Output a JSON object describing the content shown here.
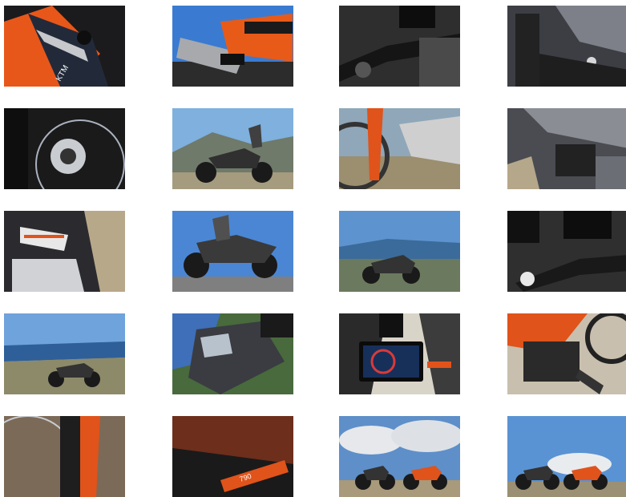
{
  "gallery": {
    "thumbnails": [
      {
        "subject": "orange-fairing-closeup"
      },
      {
        "subject": "exhaust-closeup"
      },
      {
        "subject": "handlebar-dash-closeup"
      },
      {
        "subject": "frame-closeup"
      },
      {
        "subject": "front-brake-closeup"
      },
      {
        "subject": "bike-side-mountain"
      },
      {
        "subject": "fork-closeup"
      },
      {
        "subject": "engine-closeup"
      },
      {
        "subject": "tank-shroud-closeup"
      },
      {
        "subject": "bike-side-sky"
      },
      {
        "subject": "bike-coast-view"
      },
      {
        "subject": "mirror-handlebar-closeup"
      },
      {
        "subject": "bike-sea-panorama"
      },
      {
        "subject": "headlight-closeup"
      },
      {
        "subject": "tft-dashboard"
      },
      {
        "subject": "orange-engine-closeup"
      },
      {
        "subject": "front-wheel-closeup"
      },
      {
        "subject": "tank-790-logo"
      },
      {
        "subject": "two-bikes-clouds"
      },
      {
        "subject": "two-bikes-blue-sky"
      }
    ]
  }
}
